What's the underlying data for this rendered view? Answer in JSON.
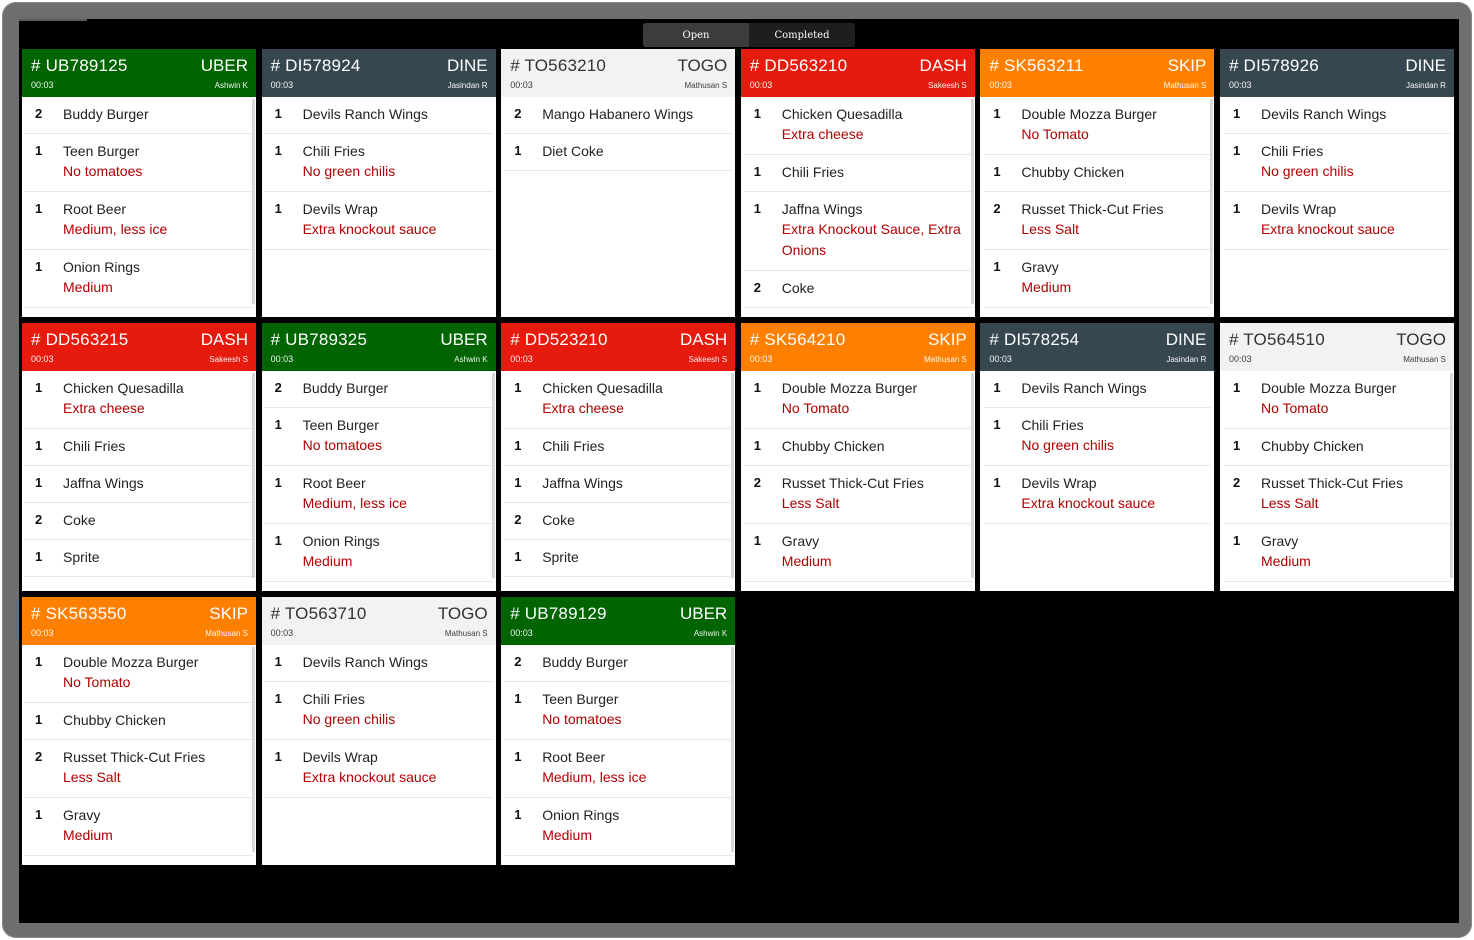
{
  "tabs": [
    {
      "label": "Open",
      "active": true
    },
    {
      "label": "Completed",
      "active": false
    }
  ],
  "colors": {
    "UBER": "#006400",
    "DINE": "#37474f",
    "TOGO": "#f2f2f2",
    "DASH": "#e61a0d",
    "SKIP": "#ff7f00",
    "modifier": "#b00000"
  },
  "orders": [
    {
      "id": "# UB789125",
      "channel": "UBER",
      "time": "00:03",
      "server": "Ashwin K",
      "scroll": true,
      "items": [
        {
          "qty": "2",
          "name": "Buddy Burger",
          "mod": ""
        },
        {
          "qty": "1",
          "name": "Teen Burger",
          "mod": "No tomatoes"
        },
        {
          "qty": "1",
          "name": "Root Beer",
          "mod": "Medium, less ice"
        },
        {
          "qty": "1",
          "name": "Onion Rings",
          "mod": "Medium"
        }
      ]
    },
    {
      "id": "# DI578924",
      "channel": "DINE",
      "time": "00:03",
      "server": "Jasindan R",
      "scroll": false,
      "items": [
        {
          "qty": "1",
          "name": "Devils Ranch Wings",
          "mod": ""
        },
        {
          "qty": "1",
          "name": "Chili Fries",
          "mod": "No green chilis"
        },
        {
          "qty": "1",
          "name": "Devils Wrap",
          "mod": "Extra knockout sauce"
        }
      ]
    },
    {
      "id": "# TO563210",
      "channel": "TOGO",
      "time": "00:03",
      "server": "Mathusan S",
      "scroll": false,
      "items": [
        {
          "qty": "2",
          "name": "Mango Habanero Wings",
          "mod": ""
        },
        {
          "qty": "1",
          "name": "Diet Coke",
          "mod": ""
        }
      ]
    },
    {
      "id": "# DD563210",
      "channel": "DASH",
      "time": "00:03",
      "server": "Sakeesh S",
      "scroll": true,
      "items": [
        {
          "qty": "1",
          "name": "Chicken Quesadilla",
          "mod": "Extra cheese"
        },
        {
          "qty": "1",
          "name": "Chili Fries",
          "mod": ""
        },
        {
          "qty": "1",
          "name": "Jaffna Wings",
          "mod": "Extra Knockout Sauce, Extra Onions"
        },
        {
          "qty": "2",
          "name": "Coke",
          "mod": ""
        }
      ]
    },
    {
      "id": "# SK563211",
      "channel": "SKIP",
      "time": "00:03",
      "server": "Mathusan S",
      "scroll": true,
      "items": [
        {
          "qty": "1",
          "name": "Double Mozza Burger",
          "mod": "No Tomato"
        },
        {
          "qty": "1",
          "name": "Chubby Chicken",
          "mod": ""
        },
        {
          "qty": "2",
          "name": "Russet Thick-Cut Fries",
          "mod": "Less Salt"
        },
        {
          "qty": "1",
          "name": "Gravy",
          "mod": "Medium"
        }
      ]
    },
    {
      "id": "# DI578926",
      "channel": "DINE",
      "time": "00:03",
      "server": "Jasindan R",
      "scroll": false,
      "items": [
        {
          "qty": "1",
          "name": "Devils Ranch Wings",
          "mod": ""
        },
        {
          "qty": "1",
          "name": "Chili Fries",
          "mod": "No green chilis"
        },
        {
          "qty": "1",
          "name": "Devils Wrap",
          "mod": "Extra knockout sauce"
        }
      ]
    },
    {
      "id": "# DD563215",
      "channel": "DASH",
      "time": "00:03",
      "server": "Sakeesh S",
      "scroll": true,
      "items": [
        {
          "qty": "1",
          "name": "Chicken Quesadilla",
          "mod": "Extra cheese"
        },
        {
          "qty": "1",
          "name": "Chili Fries",
          "mod": ""
        },
        {
          "qty": "1",
          "name": "Jaffna Wings",
          "mod": ""
        },
        {
          "qty": "2",
          "name": "Coke",
          "mod": ""
        },
        {
          "qty": "1",
          "name": "Sprite",
          "mod": ""
        }
      ]
    },
    {
      "id": "# UB789325",
      "channel": "UBER",
      "time": "00:03",
      "server": "Ashwin K",
      "scroll": true,
      "items": [
        {
          "qty": "2",
          "name": "Buddy Burger",
          "mod": ""
        },
        {
          "qty": "1",
          "name": "Teen Burger",
          "mod": "No tomatoes"
        },
        {
          "qty": "1",
          "name": "Root Beer",
          "mod": "Medium, less ice"
        },
        {
          "qty": "1",
          "name": "Onion Rings",
          "mod": "Medium"
        }
      ]
    },
    {
      "id": "# DD523210",
      "channel": "DASH",
      "time": "00:03",
      "server": "Sakeesh S",
      "scroll": true,
      "items": [
        {
          "qty": "1",
          "name": "Chicken Quesadilla",
          "mod": "Extra cheese"
        },
        {
          "qty": "1",
          "name": "Chili Fries",
          "mod": ""
        },
        {
          "qty": "1",
          "name": "Jaffna Wings",
          "mod": ""
        },
        {
          "qty": "2",
          "name": "Coke",
          "mod": ""
        },
        {
          "qty": "1",
          "name": "Sprite",
          "mod": ""
        }
      ]
    },
    {
      "id": "# SK564210",
      "channel": "SKIP",
      "time": "00:03",
      "server": "Mathusan S",
      "scroll": true,
      "items": [
        {
          "qty": "1",
          "name": "Double Mozza Burger",
          "mod": "No Tomato"
        },
        {
          "qty": "1",
          "name": "Chubby Chicken",
          "mod": ""
        },
        {
          "qty": "2",
          "name": "Russet Thick-Cut Fries",
          "mod": "Less Salt"
        },
        {
          "qty": "1",
          "name": "Gravy",
          "mod": "Medium"
        }
      ]
    },
    {
      "id": "# DI578254",
      "channel": "DINE",
      "time": "00:03",
      "server": "Jasindan R",
      "scroll": false,
      "items": [
        {
          "qty": "1",
          "name": "Devils Ranch Wings",
          "mod": ""
        },
        {
          "qty": "1",
          "name": "Chili Fries",
          "mod": "No green chilis"
        },
        {
          "qty": "1",
          "name": "Devils Wrap",
          "mod": "Extra knockout sauce"
        }
      ]
    },
    {
      "id": "# TO564510",
      "channel": "TOGO",
      "time": "00:03",
      "server": "Mathusan S",
      "scroll": true,
      "items": [
        {
          "qty": "1",
          "name": "Double Mozza Burger",
          "mod": "No Tomato"
        },
        {
          "qty": "1",
          "name": "Chubby Chicken",
          "mod": ""
        },
        {
          "qty": "2",
          "name": "Russet Thick-Cut Fries",
          "mod": "Less Salt"
        },
        {
          "qty": "1",
          "name": "Gravy",
          "mod": "Medium"
        }
      ]
    },
    {
      "id": "# SK563550",
      "channel": "SKIP",
      "time": "00:03",
      "server": "Mathusan S",
      "scroll": true,
      "items": [
        {
          "qty": "1",
          "name": "Double Mozza Burger",
          "mod": "No Tomato"
        },
        {
          "qty": "1",
          "name": "Chubby Chicken",
          "mod": ""
        },
        {
          "qty": "2",
          "name": "Russet Thick-Cut Fries",
          "mod": "Less Salt"
        },
        {
          "qty": "1",
          "name": "Gravy",
          "mod": "Medium"
        }
      ]
    },
    {
      "id": "# TO563710",
      "channel": "TOGO",
      "time": "00:03",
      "server": "Mathusan S",
      "scroll": false,
      "items": [
        {
          "qty": "1",
          "name": "Devils Ranch Wings",
          "mod": ""
        },
        {
          "qty": "1",
          "name": "Chili Fries",
          "mod": "No green chilis"
        },
        {
          "qty": "1",
          "name": "Devils Wrap",
          "mod": "Extra knockout sauce"
        }
      ]
    },
    {
      "id": "# UB789129",
      "channel": "UBER",
      "time": "00:03",
      "server": "Ashwin K",
      "scroll": true,
      "items": [
        {
          "qty": "2",
          "name": "Buddy Burger",
          "mod": ""
        },
        {
          "qty": "1",
          "name": "Teen Burger",
          "mod": "No tomatoes"
        },
        {
          "qty": "1",
          "name": "Root Beer",
          "mod": "Medium, less ice"
        },
        {
          "qty": "1",
          "name": "Onion Rings",
          "mod": "Medium"
        }
      ]
    }
  ]
}
